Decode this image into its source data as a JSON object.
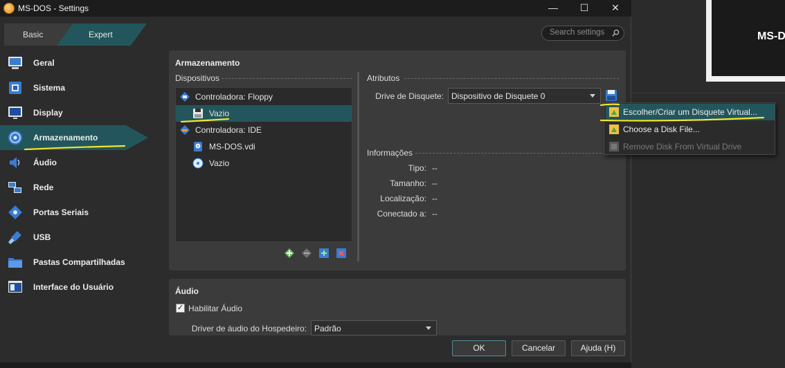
{
  "window": {
    "title": "MS-DOS - Settings",
    "min": "—",
    "max": "☐",
    "close": "✕"
  },
  "mode": {
    "basic": "Basic",
    "expert": "Expert"
  },
  "search": {
    "placeholder": "Search settings"
  },
  "nav": [
    {
      "label": "Geral",
      "icon": "monitor-icon"
    },
    {
      "label": "Sistema",
      "icon": "chip-icon"
    },
    {
      "label": "Display",
      "icon": "display-icon"
    },
    {
      "label": "Armazenamento",
      "icon": "disc-icon",
      "selected": true
    },
    {
      "label": "Áudio",
      "icon": "speaker-icon"
    },
    {
      "label": "Rede",
      "icon": "network-icon"
    },
    {
      "label": "Portas Seriais",
      "icon": "serial-icon"
    },
    {
      "label": "USB",
      "icon": "usb-icon"
    },
    {
      "label": "Pastas Compartilhadas",
      "icon": "folder-icon"
    },
    {
      "label": "Interface do Usuário",
      "icon": "ui-icon"
    }
  ],
  "storage": {
    "title": "Armazenamento",
    "devices_label": "Dispositivos",
    "tree": [
      {
        "label": "Controladora: Floppy",
        "level": 0,
        "icon": "floppy-controller-icon"
      },
      {
        "label": "Vazio",
        "level": 1,
        "icon": "floppy-icon",
        "selected": true
      },
      {
        "label": "Controladora: IDE",
        "level": 0,
        "icon": "ide-controller-icon"
      },
      {
        "label": "MS-DOS.vdi",
        "level": 1,
        "icon": "hdd-icon"
      },
      {
        "label": "Vazio",
        "level": 1,
        "icon": "cd-icon"
      }
    ],
    "attributes_label": "Atributos",
    "floppy_drive_label": "Drive de Disquete:",
    "floppy_drive_value": "Dispositivo de Disquete 0",
    "info_label": "Informações",
    "info": [
      {
        "label": "Tipo:",
        "value": "--"
      },
      {
        "label": "Tamanho:",
        "value": "--"
      },
      {
        "label": "Localização:",
        "value": "--"
      },
      {
        "label": "Conectado a:",
        "value": "--"
      }
    ]
  },
  "menu": [
    {
      "label": "Escolher/Criar um Disquete Virtual...",
      "highlighted": true
    },
    {
      "label": "Choose a Disk File..."
    },
    {
      "label": "Remove Disk From Virtual Drive",
      "disabled": true
    }
  ],
  "audio": {
    "title": "Áudio",
    "enable_label": "Habilitar Áudio",
    "enabled": true,
    "driver_label": "Driver de áudio do Hospedeiro:",
    "driver_value": "Padrão"
  },
  "buttons": {
    "ok": "OK",
    "cancel": "Cancelar",
    "help": "Ajuda (H)"
  },
  "background": {
    "preview_label": "MS-D"
  },
  "colors": {
    "accent": "#22565c",
    "annotation": "#f5e52a"
  }
}
